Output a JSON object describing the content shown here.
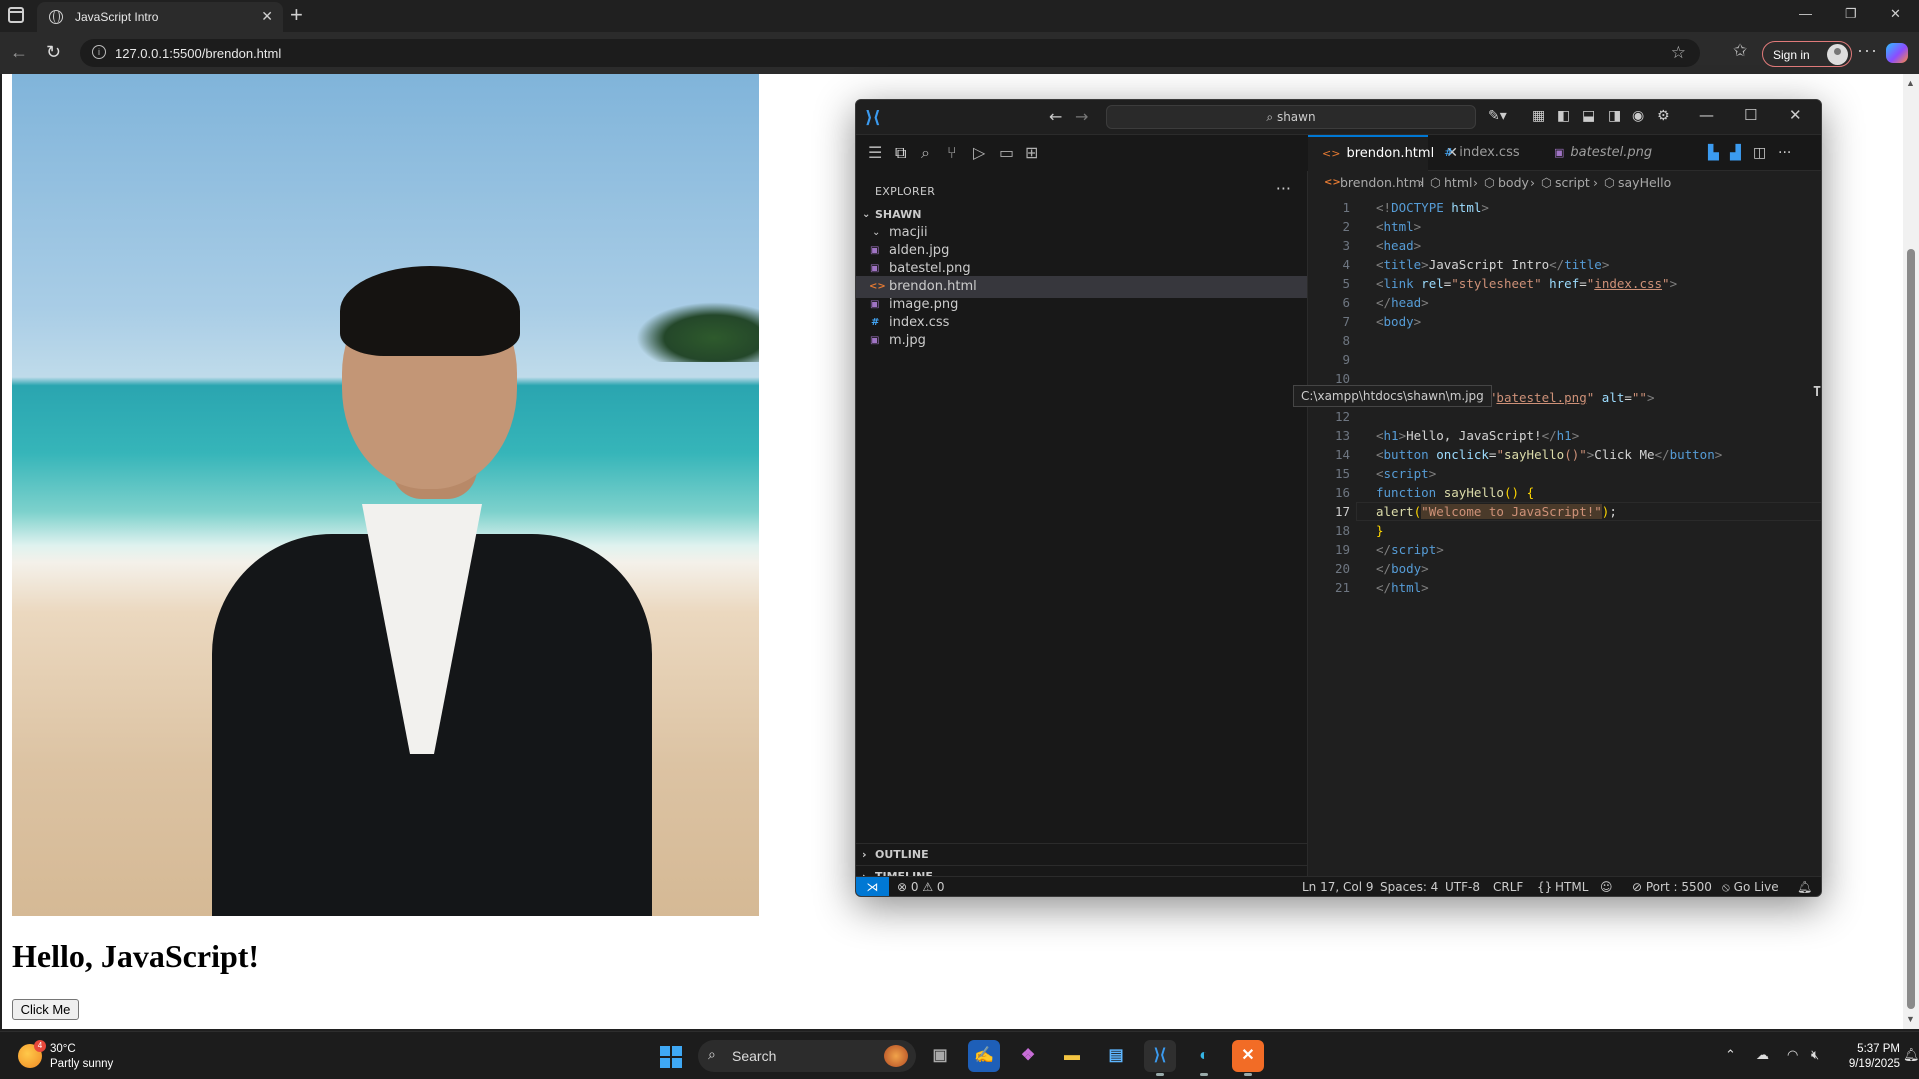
{
  "browser": {
    "tab_title": "JavaScript Intro",
    "url": "127.0.0.1:5500/brendon.html",
    "sign_in": "Sign in"
  },
  "page": {
    "heading": "Hello, JavaScript!",
    "button_label": "Click Me"
  },
  "vscode": {
    "search_text": "shawn",
    "explorer": {
      "header": "EXPLORER",
      "root": "SHAWN",
      "folder": "macjii",
      "files": [
        {
          "name": "alden.jpg",
          "icon": "image-file-icon"
        },
        {
          "name": "batestel.png",
          "icon": "image-file-icon"
        },
        {
          "name": "brendon.html",
          "icon": "html-file-icon"
        },
        {
          "name": "image.png",
          "icon": "image-file-icon"
        },
        {
          "name": "index.css",
          "icon": "css-file-icon"
        },
        {
          "name": "m.jpg",
          "icon": "image-file-icon"
        }
      ],
      "outline": "OUTLINE",
      "timeline": "TIMELINE"
    },
    "tabs": [
      "brendon.html",
      "index.css",
      "batestel.png"
    ],
    "breadcrumbs": [
      "brendon.html",
      "html",
      "body",
      "script",
      "sayHello"
    ],
    "tooltip": "C:\\xampp\\htdocs\\shawn\\m.jpg",
    "line_numbers": [
      "1",
      "2",
      "3",
      "4",
      "5",
      "6",
      "7",
      "8",
      "9",
      "10",
      "12",
      "13",
      "14",
      "15",
      "16",
      "17",
      "18",
      "19",
      "20",
      "21"
    ],
    "status": {
      "errors": "0",
      "warnings": "0",
      "position": "Ln 17, Col 9",
      "spaces": "Spaces: 4",
      "encoding": "UTF-8",
      "eol": "CRLF",
      "language": "HTML",
      "port": "Port : 5500",
      "go_live": "Go Live"
    }
  },
  "taskbar": {
    "temperature": "30°C",
    "weather": "Partly sunny",
    "weather_badge": "4",
    "search": "Search",
    "time": "5:37 PM",
    "date": "9/19/2025"
  },
  "colors": {
    "accent": "#0078d4",
    "editor_bg": "#1f1f1f",
    "sidebar_bg": "#181818"
  }
}
